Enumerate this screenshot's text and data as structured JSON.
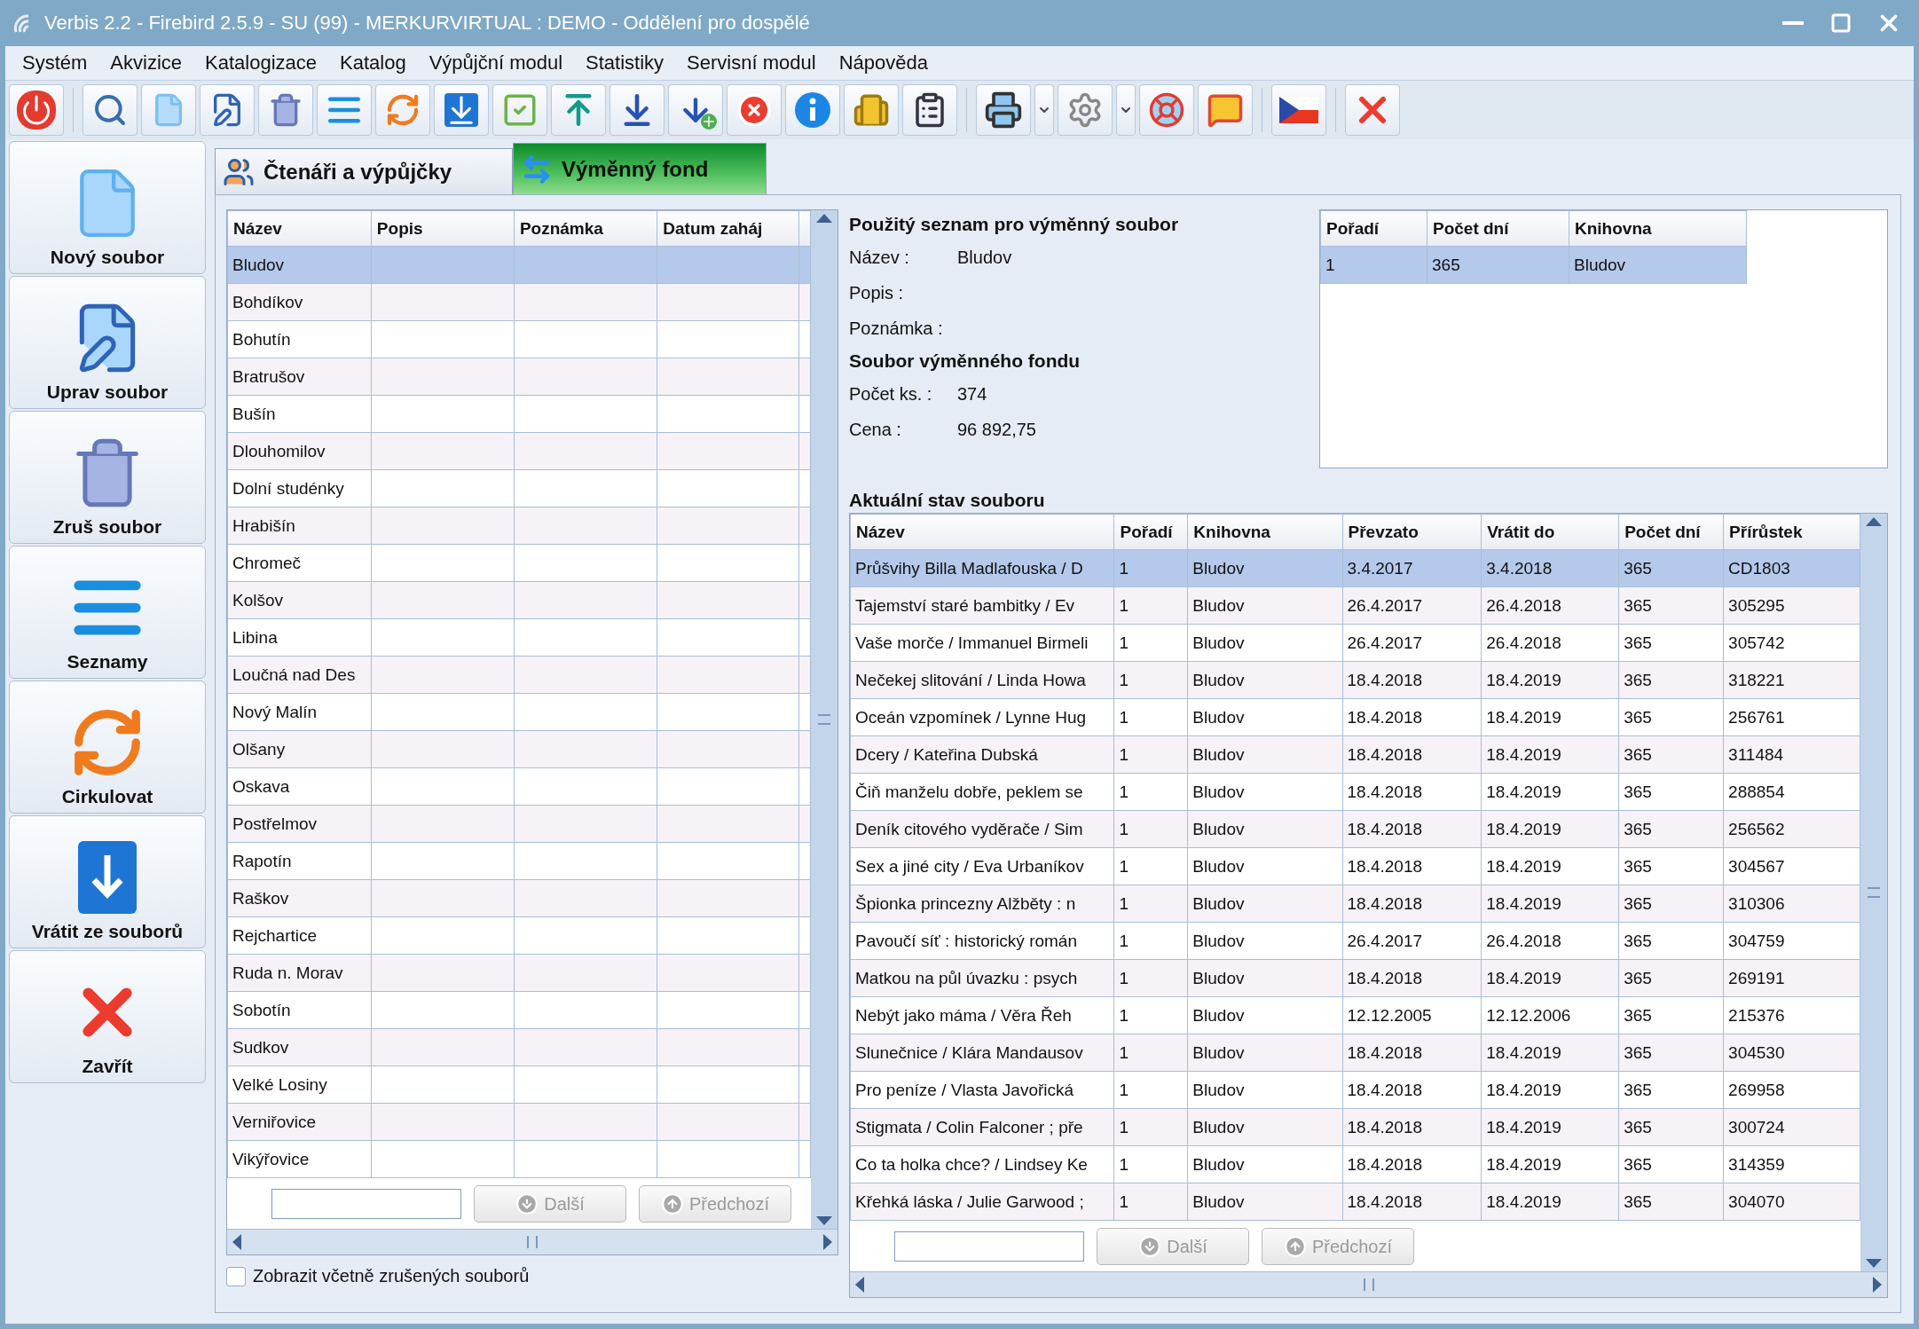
{
  "window": {
    "title": "Verbis 2.2 - Firebird 2.5.9 - SU (99) - MERKURVIRTUAL : DEMO - Oddělení pro dospělé"
  },
  "menu": [
    "Systém",
    "Akvizice",
    "Katalogizace",
    "Katalog",
    "Výpůjční modul",
    "Statistiky",
    "Servisní modul",
    "Nápověda"
  ],
  "sidebar": [
    {
      "label": "Nový soubor",
      "kind": "new"
    },
    {
      "label": "Uprav soubor",
      "kind": "edit"
    },
    {
      "label": "Zruš soubor",
      "kind": "delete"
    },
    {
      "label": "Seznamy",
      "kind": "lists"
    },
    {
      "label": "Cirkulovat",
      "kind": "circulate"
    },
    {
      "label": "Vrátit ze souborů",
      "kind": "return"
    },
    {
      "label": "Zavřít",
      "kind": "close"
    }
  ],
  "tabs": [
    {
      "label": "Čtenáři a výpůjčky",
      "kind": "readers",
      "selected": false
    },
    {
      "label": "Výměnný fond",
      "kind": "exchange",
      "selected": true
    }
  ],
  "files_table": {
    "columns": [
      "Název",
      "Popis",
      "Poznámka",
      "Datum zaháj"
    ],
    "rows": [
      {
        "name": "Bludov",
        "selected": true
      },
      {
        "name": "Bohdíkov",
        "selected": false
      },
      {
        "name": "Bohutín",
        "selected": false
      },
      {
        "name": "Bratrušov",
        "selected": false
      },
      {
        "name": "Bušín",
        "selected": false
      },
      {
        "name": "Dlouhomilov",
        "selected": false
      },
      {
        "name": "Dolní studénky",
        "selected": false
      },
      {
        "name": "Hrabišín",
        "selected": false
      },
      {
        "name": "Chromeč",
        "selected": false
      },
      {
        "name": "Kolšov",
        "selected": false
      },
      {
        "name": "Libina",
        "selected": false
      },
      {
        "name": "Loučná nad Des",
        "selected": false
      },
      {
        "name": "Nový Malín",
        "selected": false
      },
      {
        "name": "Olšany",
        "selected": false
      },
      {
        "name": "Oskava",
        "selected": false
      },
      {
        "name": "Postřelmov",
        "selected": false
      },
      {
        "name": "Rapotín",
        "selected": false
      },
      {
        "name": "Raškov",
        "selected": false
      },
      {
        "name": "Rejchartice",
        "selected": false
      },
      {
        "name": "Ruda n. Morav",
        "selected": false
      },
      {
        "name": "Sobotín",
        "selected": false
      },
      {
        "name": "Sudkov",
        "selected": false
      },
      {
        "name": "Velké Losiny",
        "selected": false
      },
      {
        "name": "Verniřovice",
        "selected": false
      },
      {
        "name": "Vikýřovice",
        "selected": false
      }
    ]
  },
  "files_search": {
    "buttons": [
      {
        "label": "Další",
        "kind": "next",
        "disabled": true
      },
      {
        "label": "Předchozí",
        "kind": "previous",
        "disabled": true
      }
    ]
  },
  "show_cancelled": {
    "label": "Zobrazit včetně zrušených souborů",
    "checked": false
  },
  "list_info": {
    "title": "Použitý seznam pro výměnný soubor",
    "fields": [
      {
        "label": "Název :",
        "value": "Bludov"
      },
      {
        "label": "Popis :"
      },
      {
        "label": "Poznámka :"
      }
    ]
  },
  "fund_info": {
    "title": "Soubor výměnného fondu",
    "fields": [
      {
        "label": "Počet ks. :",
        "value": "374"
      },
      {
        "label": "Cena :",
        "value": "96 892,75"
      }
    ]
  },
  "order_table": {
    "columns": [
      "Pořadí",
      "Počet dní",
      "Knihovna"
    ],
    "rows": [
      {
        "cells": [
          "1",
          "365",
          "Bludov"
        ],
        "selected": true
      }
    ]
  },
  "state": {
    "title": "Aktuální stav souboru",
    "columns": [
      "Název",
      "Pořadí",
      "Knihovna",
      "Převzato",
      "Vrátit do",
      "Počet dní",
      "Přírůstek"
    ],
    "rows": [
      {
        "cells": [
          "Průšvihy Billa Madlafouska / D",
          "1",
          "Bludov",
          "3.4.2017",
          "3.4.2018",
          "365",
          "CD1803"
        ],
        "selected": true
      },
      {
        "cells": [
          "Tajemství staré bambitky / Ev",
          "1",
          "Bludov",
          "26.4.2017",
          "26.4.2018",
          "365",
          "305295"
        ],
        "selected": false
      },
      {
        "cells": [
          "Vaše morče / Immanuel Birmeli",
          "1",
          "Bludov",
          "26.4.2017",
          "26.4.2018",
          "365",
          "305742"
        ],
        "selected": false
      },
      {
        "cells": [
          "Nečekej slitování / Linda Howa",
          "1",
          "Bludov",
          "18.4.2018",
          "18.4.2019",
          "365",
          "318221"
        ],
        "selected": false
      },
      {
        "cells": [
          "Oceán vzpomínek / Lynne Hug",
          "1",
          "Bludov",
          "18.4.2018",
          "18.4.2019",
          "365",
          "256761"
        ],
        "selected": false
      },
      {
        "cells": [
          "Dcery / Kateřina Dubská",
          "1",
          "Bludov",
          "18.4.2018",
          "18.4.2019",
          "365",
          "311484"
        ],
        "selected": false
      },
      {
        "cells": [
          "Čiň manželu dobře, peklem se",
          "1",
          "Bludov",
          "18.4.2018",
          "18.4.2019",
          "365",
          "288854"
        ],
        "selected": false
      },
      {
        "cells": [
          "Deník citového vyděrače / Sim",
          "1",
          "Bludov",
          "18.4.2018",
          "18.4.2019",
          "365",
          "256562"
        ],
        "selected": false
      },
      {
        "cells": [
          "Sex a jiné city / Eva Urbaníkov",
          "1",
          "Bludov",
          "18.4.2018",
          "18.4.2019",
          "365",
          "304567"
        ],
        "selected": false
      },
      {
        "cells": [
          "Špionka princezny Alžběty : n",
          "1",
          "Bludov",
          "18.4.2018",
          "18.4.2019",
          "365",
          "310306"
        ],
        "selected": false
      },
      {
        "cells": [
          "Pavoučí síť : historický román",
          "1",
          "Bludov",
          "26.4.2017",
          "26.4.2018",
          "365",
          "304759"
        ],
        "selected": false
      },
      {
        "cells": [
          "Matkou na půl úvazku : psych",
          "1",
          "Bludov",
          "18.4.2018",
          "18.4.2019",
          "365",
          "269191"
        ],
        "selected": false
      },
      {
        "cells": [
          "Nebýt jako máma / Věra Řeh",
          "1",
          "Bludov",
          "12.12.2005",
          "12.12.2006",
          "365",
          "215376"
        ],
        "selected": false
      },
      {
        "cells": [
          "Slunečnice / Klára Mandausov",
          "1",
          "Bludov",
          "18.4.2018",
          "18.4.2019",
          "365",
          "304530"
        ],
        "selected": false
      },
      {
        "cells": [
          "Pro peníze / Vlasta Javořická",
          "1",
          "Bludov",
          "18.4.2018",
          "18.4.2019",
          "365",
          "269958"
        ],
        "selected": false
      },
      {
        "cells": [
          "Stigmata / Colin Falconer ; pře",
          "1",
          "Bludov",
          "18.4.2018",
          "18.4.2019",
          "365",
          "300724"
        ],
        "selected": false
      },
      {
        "cells": [
          "Co ta holka chce? / Lindsey Ke",
          "1",
          "Bludov",
          "18.4.2018",
          "18.4.2019",
          "365",
          "314359"
        ],
        "selected": false
      },
      {
        "cells": [
          "Křehká láska / Julie Garwood ;",
          "1",
          "Bludov",
          "18.4.2018",
          "18.4.2019",
          "365",
          "304070"
        ],
        "selected": false
      }
    ]
  },
  "state_search": {
    "buttons": [
      {
        "label": "Další",
        "kind": "next",
        "disabled": true
      },
      {
        "label": "Předchozí",
        "kind": "previous",
        "disabled": true
      }
    ]
  }
}
